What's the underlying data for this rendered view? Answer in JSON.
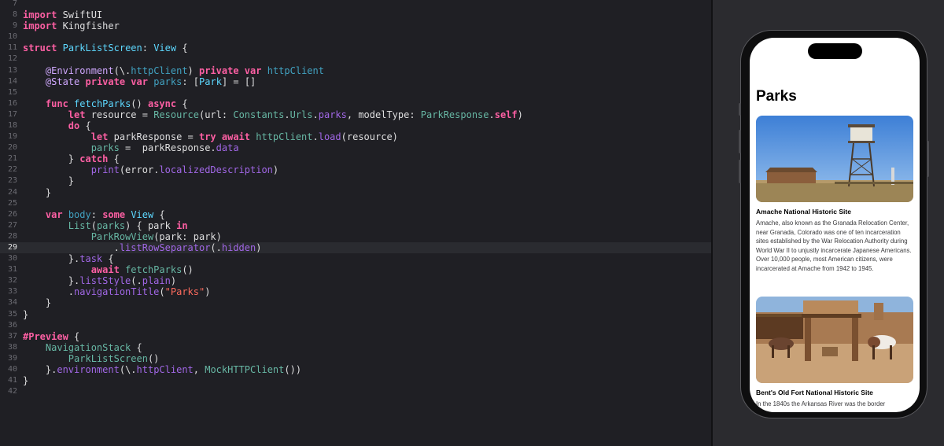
{
  "editor": {
    "lines": [
      {
        "num": "7",
        "html": ""
      },
      {
        "num": "8",
        "html": "<span class='kw'>import</span> SwiftUI"
      },
      {
        "num": "9",
        "html": "<span class='kw'>import</span> Kingfisher"
      },
      {
        "num": "10",
        "html": ""
      },
      {
        "num": "11",
        "html": "<span class='kw'>struct</span> <span class='ty'>ParkListScreen</span>: <span class='ty'>View</span> {"
      },
      {
        "num": "12",
        "html": ""
      },
      {
        "num": "13",
        "html": "    <span class='attr'>@Environment</span>(\\.<span class='prop'>httpClient</span>) <span class='kw'>private var</span> <span class='prop'>httpClient</span>"
      },
      {
        "num": "14",
        "html": "    <span class='attr'>@State</span> <span class='kw'>private var</span> <span class='prop'>parks</span>: [<span class='ty'>Park</span>] = []"
      },
      {
        "num": "15",
        "html": ""
      },
      {
        "num": "16",
        "html": "    <span class='kw'>func</span> <span class='ty'>fetchParks</span>() <span class='kw'>async</span> {"
      },
      {
        "num": "17",
        "html": "        <span class='kw'>let</span> resource = <span class='fn'>Resource</span>(url: <span class='fn'>Constants</span>.<span class='fn'>Urls</span>.<span class='mem'>parks</span>, modelType: <span class='fn'>ParkResponse</span>.<span class='kw'>self</span>)"
      },
      {
        "num": "18",
        "html": "        <span class='kw'>do</span> {"
      },
      {
        "num": "19",
        "html": "            <span class='kw'>let</span> parkResponse = <span class='kw'>try await</span> <span class='fn'>httpClient</span>.<span class='mem'>load</span>(resource)"
      },
      {
        "num": "20",
        "html": "            <span class='fn'>parks</span> =  parkResponse.<span class='mem'>data</span>"
      },
      {
        "num": "21",
        "html": "        } <span class='kw'>catch</span> {"
      },
      {
        "num": "22",
        "html": "            <span class='mem'>print</span>(error.<span class='mem'>localizedDescription</span>)"
      },
      {
        "num": "23",
        "html": "        }"
      },
      {
        "num": "24",
        "html": "    }"
      },
      {
        "num": "25",
        "html": ""
      },
      {
        "num": "26",
        "html": "    <span class='kw'>var</span> <span class='prop'>body</span>: <span class='kw'>some</span> <span class='ty'>View</span> {"
      },
      {
        "num": "27",
        "html": "        <span class='fn'>List</span>(<span class='fn'>parks</span>) { park <span class='kw'>in</span>"
      },
      {
        "num": "28",
        "html": "            <span class='fn'>ParkRowView</span>(park: park)"
      },
      {
        "num": "29",
        "html": "                .<span class='mem'>listRowSeparator</span>(.<span class='mem'>hidden</span>)",
        "current": true
      },
      {
        "num": "30",
        "html": "        }.<span class='mem'>task</span> {"
      },
      {
        "num": "31",
        "html": "            <span class='kw'>await</span> <span class='fn'>fetchParks</span>()"
      },
      {
        "num": "32",
        "html": "        }.<span class='mem'>listStyle</span>(.<span class='mem'>plain</span>)"
      },
      {
        "num": "33",
        "html": "        .<span class='mem'>navigationTitle</span>(<span class='str'>\"Parks\"</span>)"
      },
      {
        "num": "34",
        "html": "    }"
      },
      {
        "num": "35",
        "html": "}"
      },
      {
        "num": "36",
        "html": ""
      },
      {
        "num": "37",
        "html": "<span class='kw'>#Preview</span> {"
      },
      {
        "num": "38",
        "html": "    <span class='fn'>NavigationStack</span> {"
      },
      {
        "num": "39",
        "html": "        <span class='fn'>ParkListScreen</span>()"
      },
      {
        "num": "40",
        "html": "    }.<span class='mem'>environment</span>(\\.<span class='mem'>httpClient</span>, <span class='fn'>MockHTTPClient</span>())"
      },
      {
        "num": "41",
        "html": "}"
      },
      {
        "num": "42",
        "html": ""
      }
    ]
  },
  "preview": {
    "nav_title": "Parks",
    "parks": [
      {
        "name": "Amache National Historic Site",
        "description": "Amache, also known as the Granada Relocation Center, near Granada, Colorado was one of ten incarceration sites established by the War Relocation Authority during World War II to unjustly incarcerate Japanese Americans. Over 10,000 people, most American citizens, were incarcerated at Amache from 1942 to 1945."
      },
      {
        "name": "Bent's Old Fort National Historic Site",
        "description": "In the 1840s the Arkansas River was the border"
      }
    ]
  },
  "colors": {
    "editor_bg": "#1f1f24",
    "keyword": "#fc5fa3",
    "type": "#5dd8ff",
    "function": "#67b7a4",
    "member": "#a167e6",
    "string": "#fc6a5d"
  }
}
